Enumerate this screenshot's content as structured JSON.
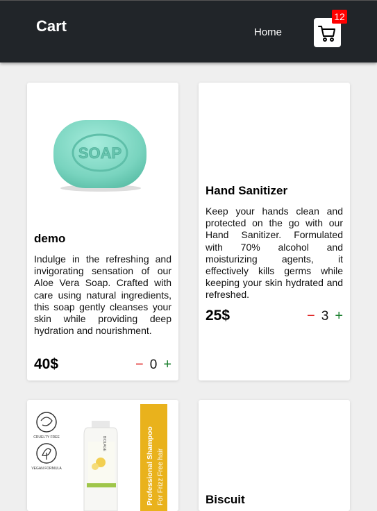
{
  "navbar": {
    "brand": "Cart",
    "home_label": "Home",
    "cart_count": "12"
  },
  "products": [
    {
      "title": "demo",
      "description": "Indulge in the refreshing and invigorating sensation of our Aloe Vera Soap. Crafted with care using natural ingredients, this soap gently cleanses your skin while providing deep hydration and nourishment.",
      "price": "40$",
      "quantity": "0",
      "image_text": "SOAP"
    },
    {
      "title": "Hand Sanitizer",
      "description": "Keep your hands clean and protected on the go with our Hand Sanitizer. Formulated with 70% alcohol and moisturizing agents, it effectively kills germs while keeping your skin hydrated and refreshed.",
      "price": "25$",
      "quantity": "3"
    },
    {
      "image_banner_line1": "Professional Shampoo",
      "image_banner_line2": "For Frizz Free hair",
      "image_badge1": "CRUELTY FREE",
      "image_badge2": "VEGAN FORMULA",
      "image_bottle_label": "BIOLAGE"
    },
    {
      "title": "Biscuit"
    }
  ],
  "qty_controls": {
    "minus": "−",
    "plus": "+"
  },
  "colors": {
    "navbar": "#212529",
    "badge": "#ff0000",
    "minus": "#e02424",
    "plus": "#1a7f2e",
    "soap": "#7fd8c4"
  }
}
